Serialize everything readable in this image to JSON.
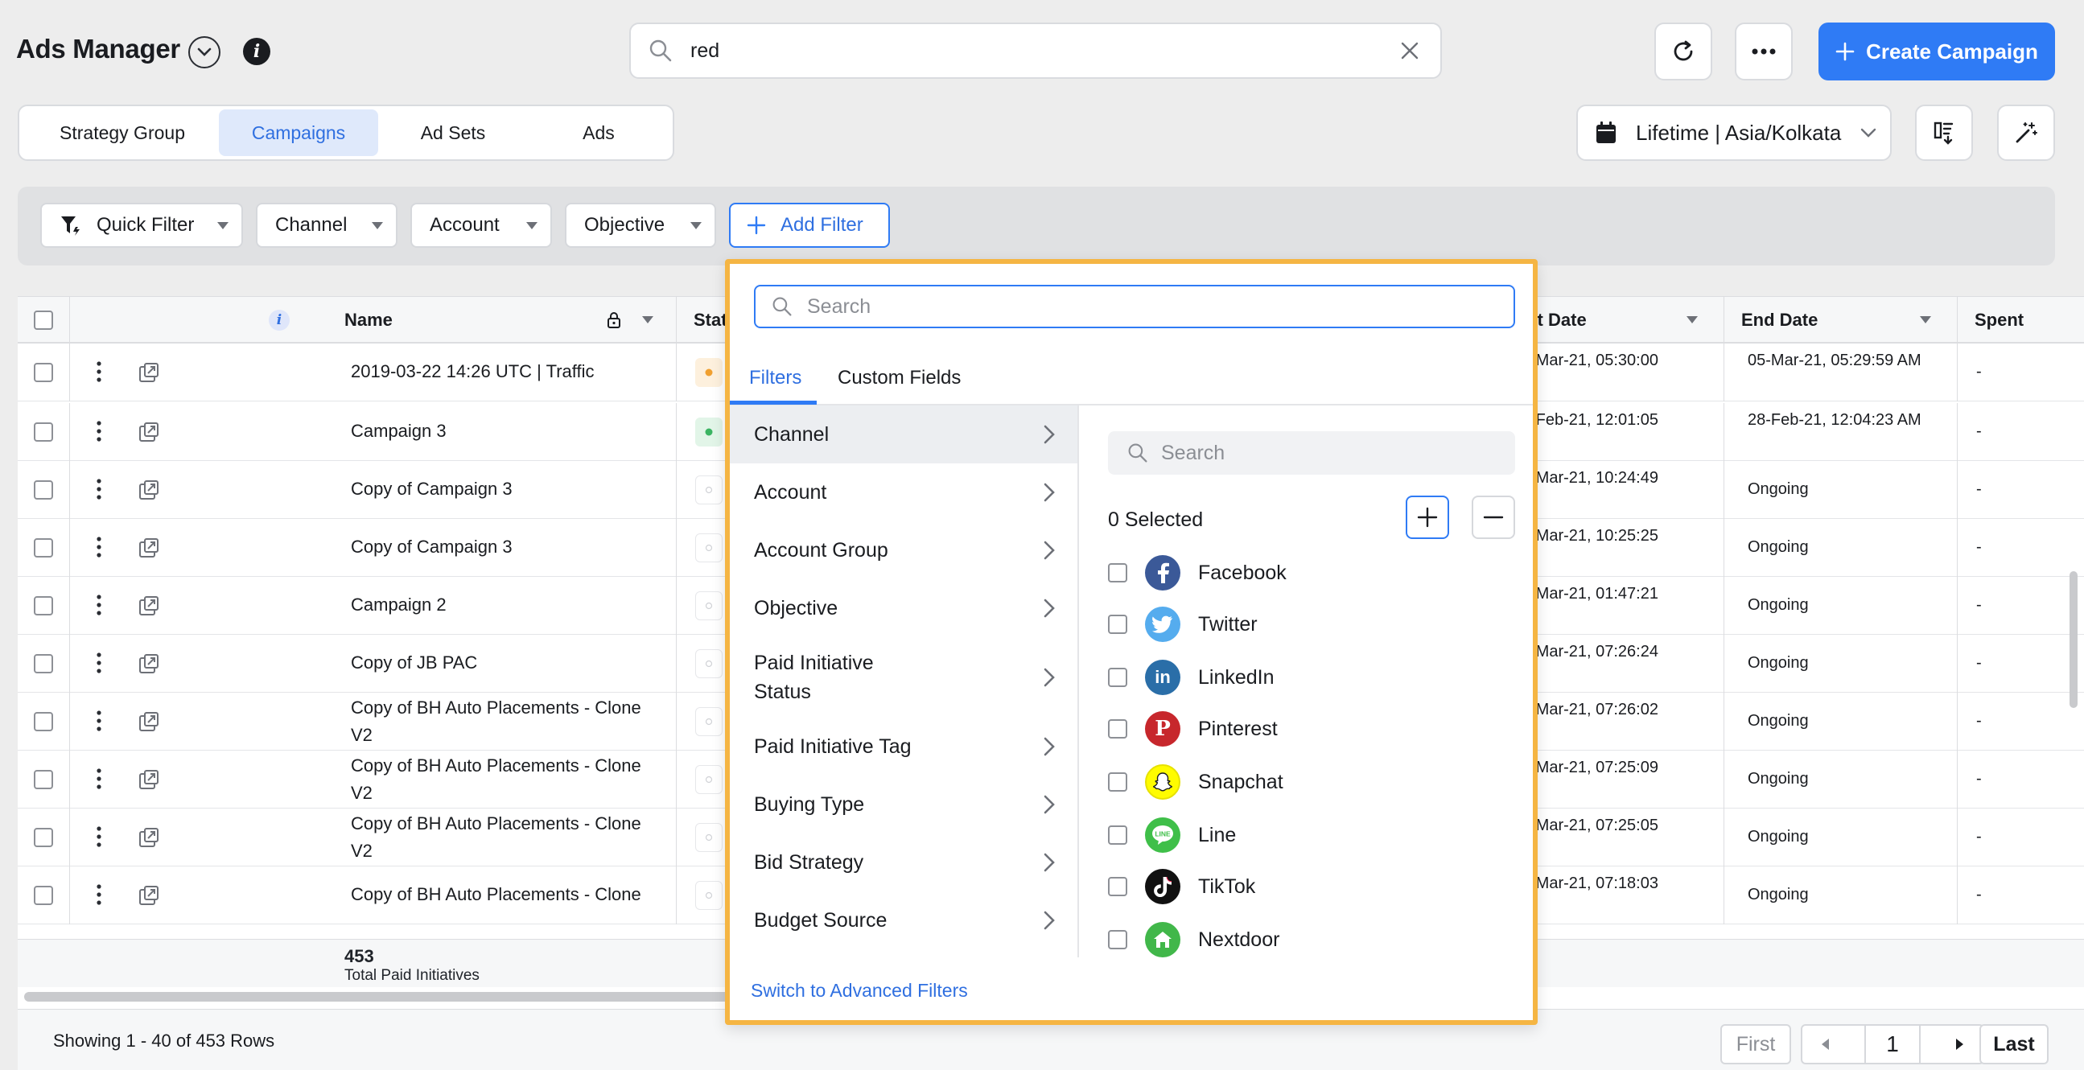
{
  "header": {
    "title": "Ads Manager",
    "search_value": "red",
    "create_label": "Create Campaign"
  },
  "tabs": [
    {
      "label": "Strategy Group",
      "active": false
    },
    {
      "label": "Campaigns",
      "active": true
    },
    {
      "label": "Ad Sets",
      "active": false
    },
    {
      "label": "Ads",
      "active": false
    }
  ],
  "date_selector": {
    "label": "Lifetime | Asia/Kolkata"
  },
  "filters": {
    "quick_filter": "Quick Filter",
    "channel": "Channel",
    "account": "Account",
    "objective": "Objective",
    "add_filter": "Add Filter"
  },
  "table": {
    "columns": {
      "name": "Name",
      "status_partial": "Stat",
      "start_date_partial": "rt Date",
      "end_date": "End Date",
      "spent": "Spent"
    },
    "rows": [
      {
        "name": "2019-03-22 14:26 UTC | Traffic",
        "status": "orange",
        "start": "-Mar-21, 05:30:00",
        "end": "05-Mar-21, 05:29:59 AM",
        "spent": "-"
      },
      {
        "name": "Campaign 3",
        "status": "green",
        "start": "-Feb-21, 12:01:05",
        "end": "28-Feb-21, 12:04:23 AM",
        "spent": "-"
      },
      {
        "name": "Copy of Campaign 3",
        "status": "empty",
        "start": "-Mar-21, 10:24:49",
        "end": "Ongoing",
        "spent": "-"
      },
      {
        "name": "Copy of Campaign 3",
        "status": "empty",
        "start": "-Mar-21, 10:25:25",
        "end": "Ongoing",
        "spent": "-"
      },
      {
        "name": "Campaign 2",
        "status": "empty",
        "start": "-Mar-21, 01:47:21",
        "end": "Ongoing",
        "spent": "-"
      },
      {
        "name": "Copy of JB PAC",
        "status": "empty",
        "start": "-Mar-21, 07:26:24",
        "end": "Ongoing",
        "spent": "-"
      },
      {
        "name": "Copy of BH Auto Placements - Clone V2",
        "status": "empty",
        "start": "-Mar-21, 07:26:02",
        "end": "Ongoing",
        "spent": "-"
      },
      {
        "name": "Copy of BH Auto Placements - Clone V2",
        "status": "empty",
        "start": "-Mar-21, 07:25:09",
        "end": "Ongoing",
        "spent": "-"
      },
      {
        "name": "Copy of BH Auto Placements - Clone V2",
        "status": "empty",
        "start": "-Mar-21, 07:25:05",
        "end": "Ongoing",
        "spent": "-"
      },
      {
        "name": "Copy of BH Auto Placements - Clone",
        "status": "empty",
        "start": "-Mar-21, 07:18:03",
        "end": "Ongoing",
        "spent": "-"
      }
    ],
    "total_count": "453",
    "total_label": "Total Paid Initiatives"
  },
  "footer": {
    "showing": "Showing 1 - 40 of 453 Rows",
    "first": "First",
    "page": "1",
    "last": "Last"
  },
  "popup": {
    "search_placeholder": "Search",
    "tab_filters": "Filters",
    "tab_custom": "Custom Fields",
    "categories": [
      "Channel",
      "Account",
      "Account Group",
      "Objective",
      "Paid Initiative Status",
      "Paid Initiative Tag",
      "Buying Type",
      "Bid Strategy",
      "Budget Source"
    ],
    "inner_search_placeholder": "Search",
    "selected_label": "0 Selected",
    "channels": [
      {
        "name": "Facebook",
        "icon": "facebook-icon",
        "color": "#3b5998"
      },
      {
        "name": "Twitter",
        "icon": "twitter-icon",
        "color": "#55acee"
      },
      {
        "name": "LinkedIn",
        "icon": "linkedin-icon",
        "color": "#2a6ea8"
      },
      {
        "name": "Pinterest",
        "icon": "pinterest-icon",
        "color": "#c7272c"
      },
      {
        "name": "Snapchat",
        "icon": "snapchat-icon",
        "color": "#fffc00"
      },
      {
        "name": "Line",
        "icon": "line-icon",
        "color": "#3fbf49"
      },
      {
        "name": "TikTok",
        "icon": "tiktok-icon",
        "color": "#111111"
      },
      {
        "name": "Nextdoor",
        "icon": "nextdoor-icon",
        "color": "#41b74a"
      }
    ],
    "advanced_link": "Switch to Advanced Filters"
  },
  "colors": {
    "accent": "#2f7bf5",
    "popup_border": "#f5b543"
  }
}
